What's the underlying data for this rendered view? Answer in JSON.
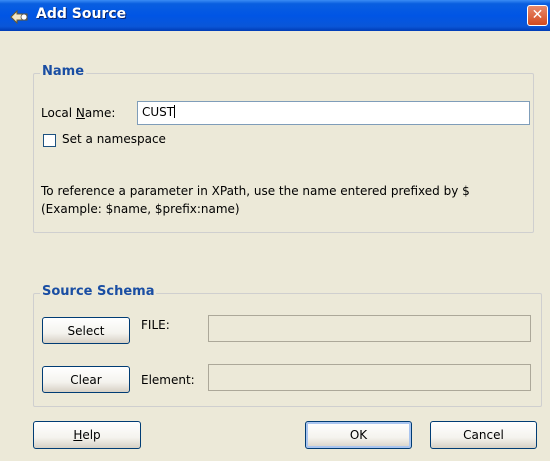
{
  "window": {
    "title": "Add Source",
    "close_label": "✕"
  },
  "name_group": {
    "title": "Name",
    "local_name_label_prefix": "Local ",
    "local_name_label_mnemonic": "N",
    "local_name_label_suffix": "ame:",
    "local_name_value": "CUST",
    "namespace_checkbox_label": "Set a namespace",
    "namespace_checked": false,
    "info_line1": "To reference a parameter in XPath, use the name entered prefixed by $",
    "info_line2": "(Example: $name, $prefix:name)"
  },
  "schema_group": {
    "title": "Source Schema",
    "select_button": "Select",
    "file_label": "FILE:",
    "file_value": "",
    "clear_button": "Clear",
    "element_label": "Element:",
    "element_value": ""
  },
  "buttons": {
    "help_mnemonic": "H",
    "help_rest": "elp",
    "ok": "OK",
    "cancel": "Cancel"
  }
}
